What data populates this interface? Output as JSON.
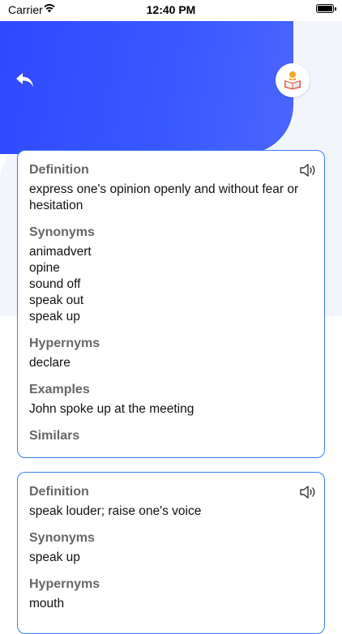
{
  "status_bar": {
    "carrier": "Carrier",
    "time": "12:40 PM"
  },
  "header": {
    "back_icon": "back-arrow-icon",
    "reader_icon": "book-reader-icon"
  },
  "colors": {
    "accent": "#2f48ff",
    "card_border": "#3b7cf0",
    "background": "#f3f5fd"
  },
  "cards": [
    {
      "definition_label": "Definition",
      "definition": "express one's opinion openly and without fear or hesitation",
      "synonyms_label": "Synonyms",
      "synonyms": [
        "animadvert",
        "opine",
        "sound off",
        "speak out",
        "speak up"
      ],
      "hypernyms_label": "Hypernyms",
      "hypernyms": [
        "declare"
      ],
      "examples_label": "Examples",
      "examples": [
        "John spoke up at the meeting"
      ],
      "similars_label": "Similars"
    },
    {
      "definition_label": "Definition",
      "definition": "speak louder; raise one's voice",
      "synonyms_label": "Synonyms",
      "synonyms": [
        "speak up"
      ],
      "hypernyms_label": "Hypernyms",
      "hypernyms": [
        "mouth"
      ]
    }
  ]
}
